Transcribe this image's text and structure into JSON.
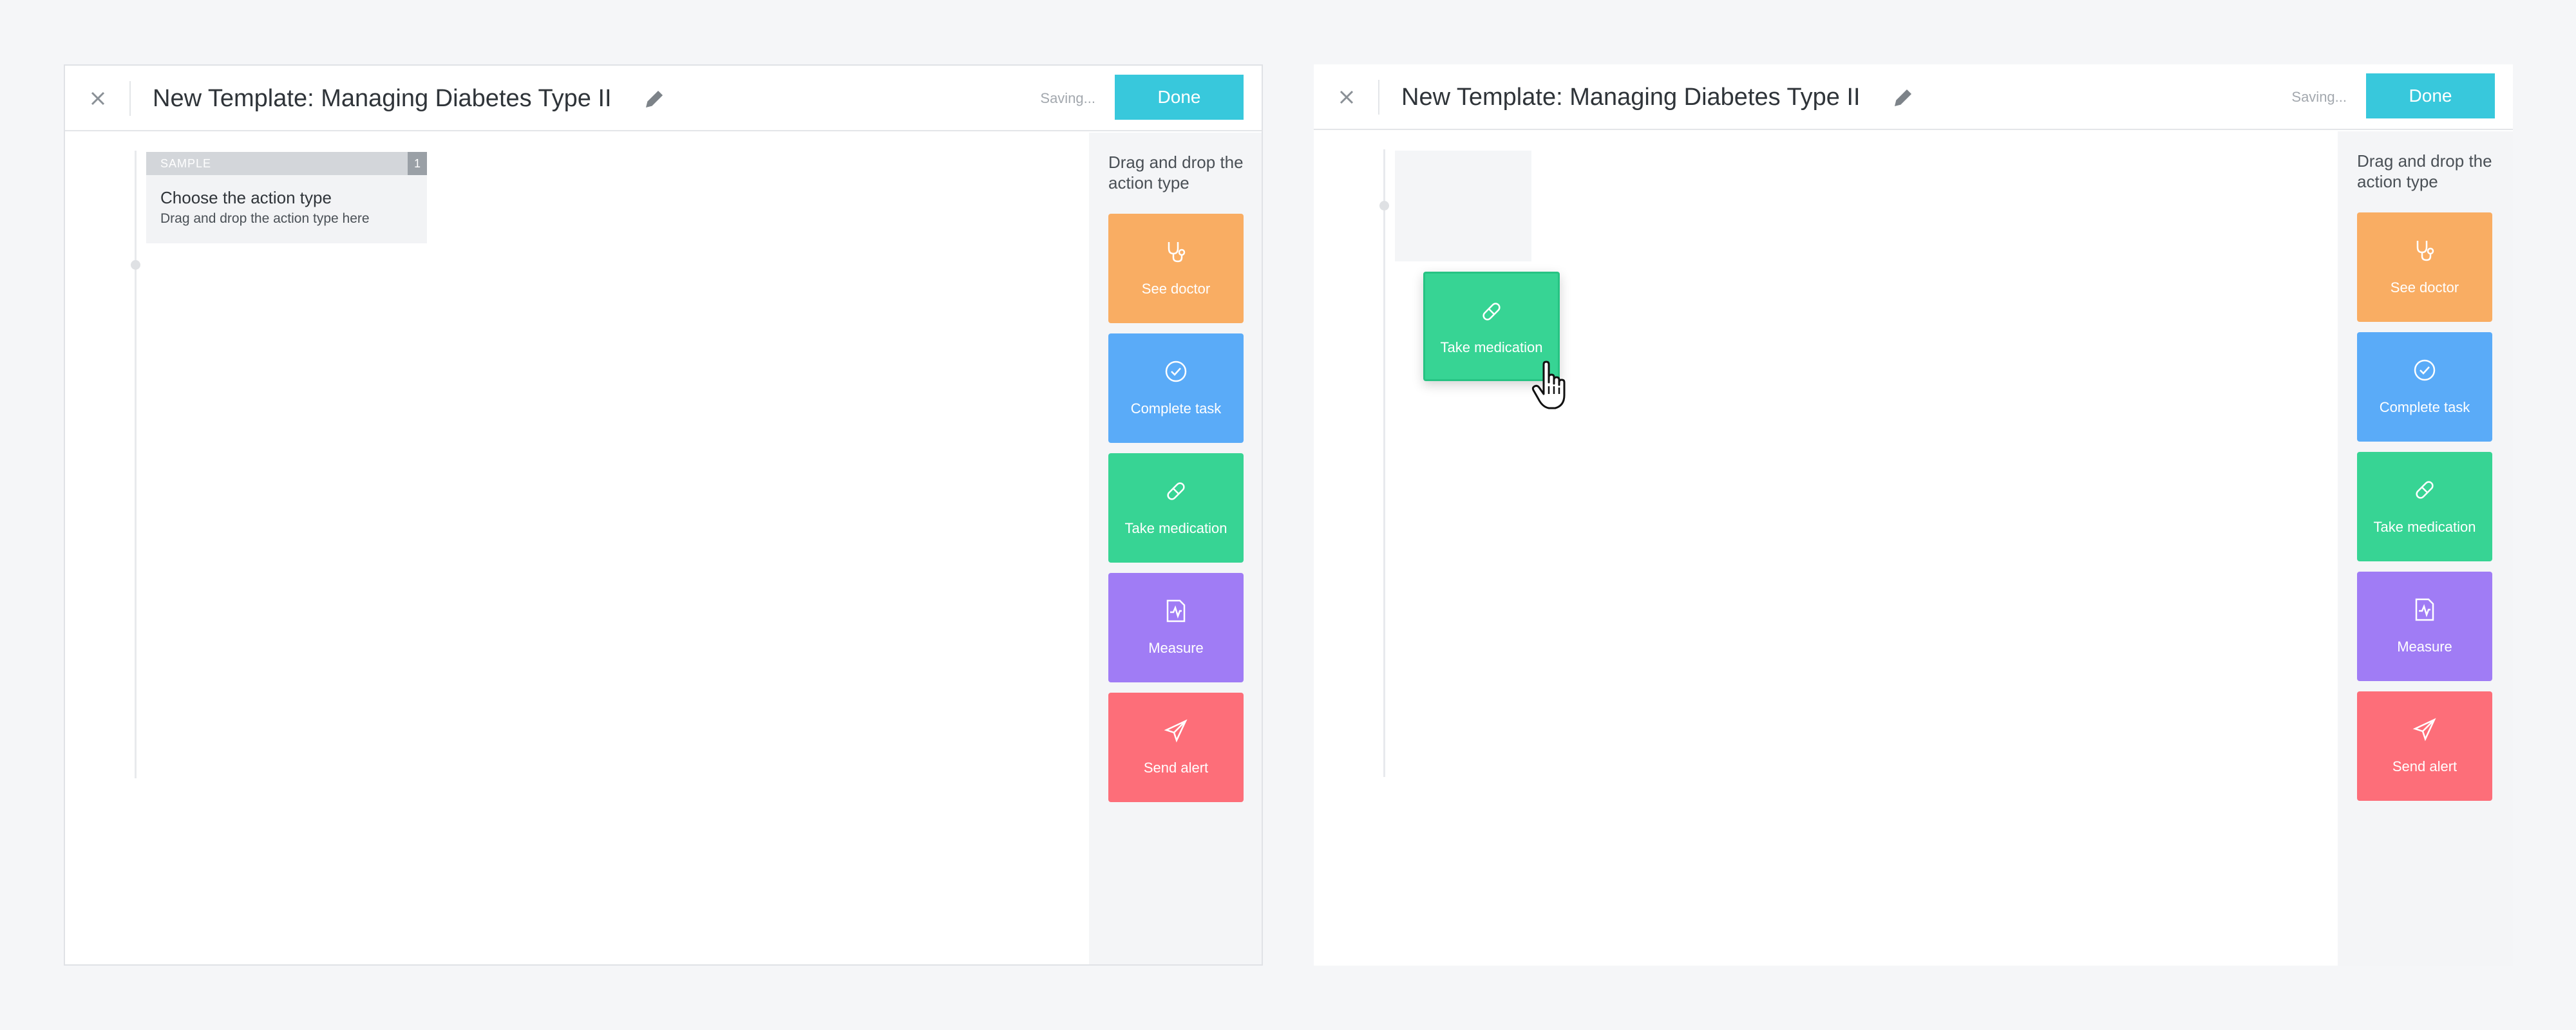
{
  "screens": {
    "left": {
      "header": {
        "title": "New Template: Managing Diabetes Type II",
        "status": "Saving...",
        "done_label": "Done"
      },
      "sample_card": {
        "badge": "SAMPLE",
        "count": "1",
        "title": "Choose the action type",
        "subtitle": "Drag and drop the action type here"
      },
      "sidebar": {
        "heading": "Drag and drop the action type",
        "tiles": [
          {
            "label": "See doctor",
            "icon": "stethoscope-icon",
            "color": "#f9ad63"
          },
          {
            "label": "Complete task",
            "icon": "check-circle-icon",
            "color": "#5aabf8"
          },
          {
            "label": "Take medication",
            "icon": "pill-icon",
            "color": "#37d494"
          },
          {
            "label": "Measure",
            "icon": "pulse-document-icon",
            "color": "#a07cf5"
          },
          {
            "label": "Send alert",
            "icon": "paper-plane-icon",
            "color": "#fd6e79"
          }
        ]
      }
    },
    "right": {
      "header": {
        "title": "New Template: Managing Diabetes Type II",
        "status": "Saving...",
        "done_label": "Done"
      },
      "dragged_tile": {
        "label": "Take medication",
        "icon": "pill-icon",
        "color": "#37d494"
      },
      "sidebar": {
        "heading": "Drag and drop the action type",
        "tiles": [
          {
            "label": "See doctor",
            "icon": "stethoscope-icon",
            "color": "#f9ad63"
          },
          {
            "label": "Complete task",
            "icon": "check-circle-icon",
            "color": "#5aabf8"
          },
          {
            "label": "Take medication",
            "icon": "pill-icon",
            "color": "#37d494"
          },
          {
            "label": "Measure",
            "icon": "pulse-document-icon",
            "color": "#a07cf5"
          },
          {
            "label": "Send alert",
            "icon": "paper-plane-icon",
            "color": "#fd6e79"
          }
        ]
      }
    }
  },
  "colors": {
    "accent": "#38c8dc",
    "background": "#f5f6f8"
  }
}
